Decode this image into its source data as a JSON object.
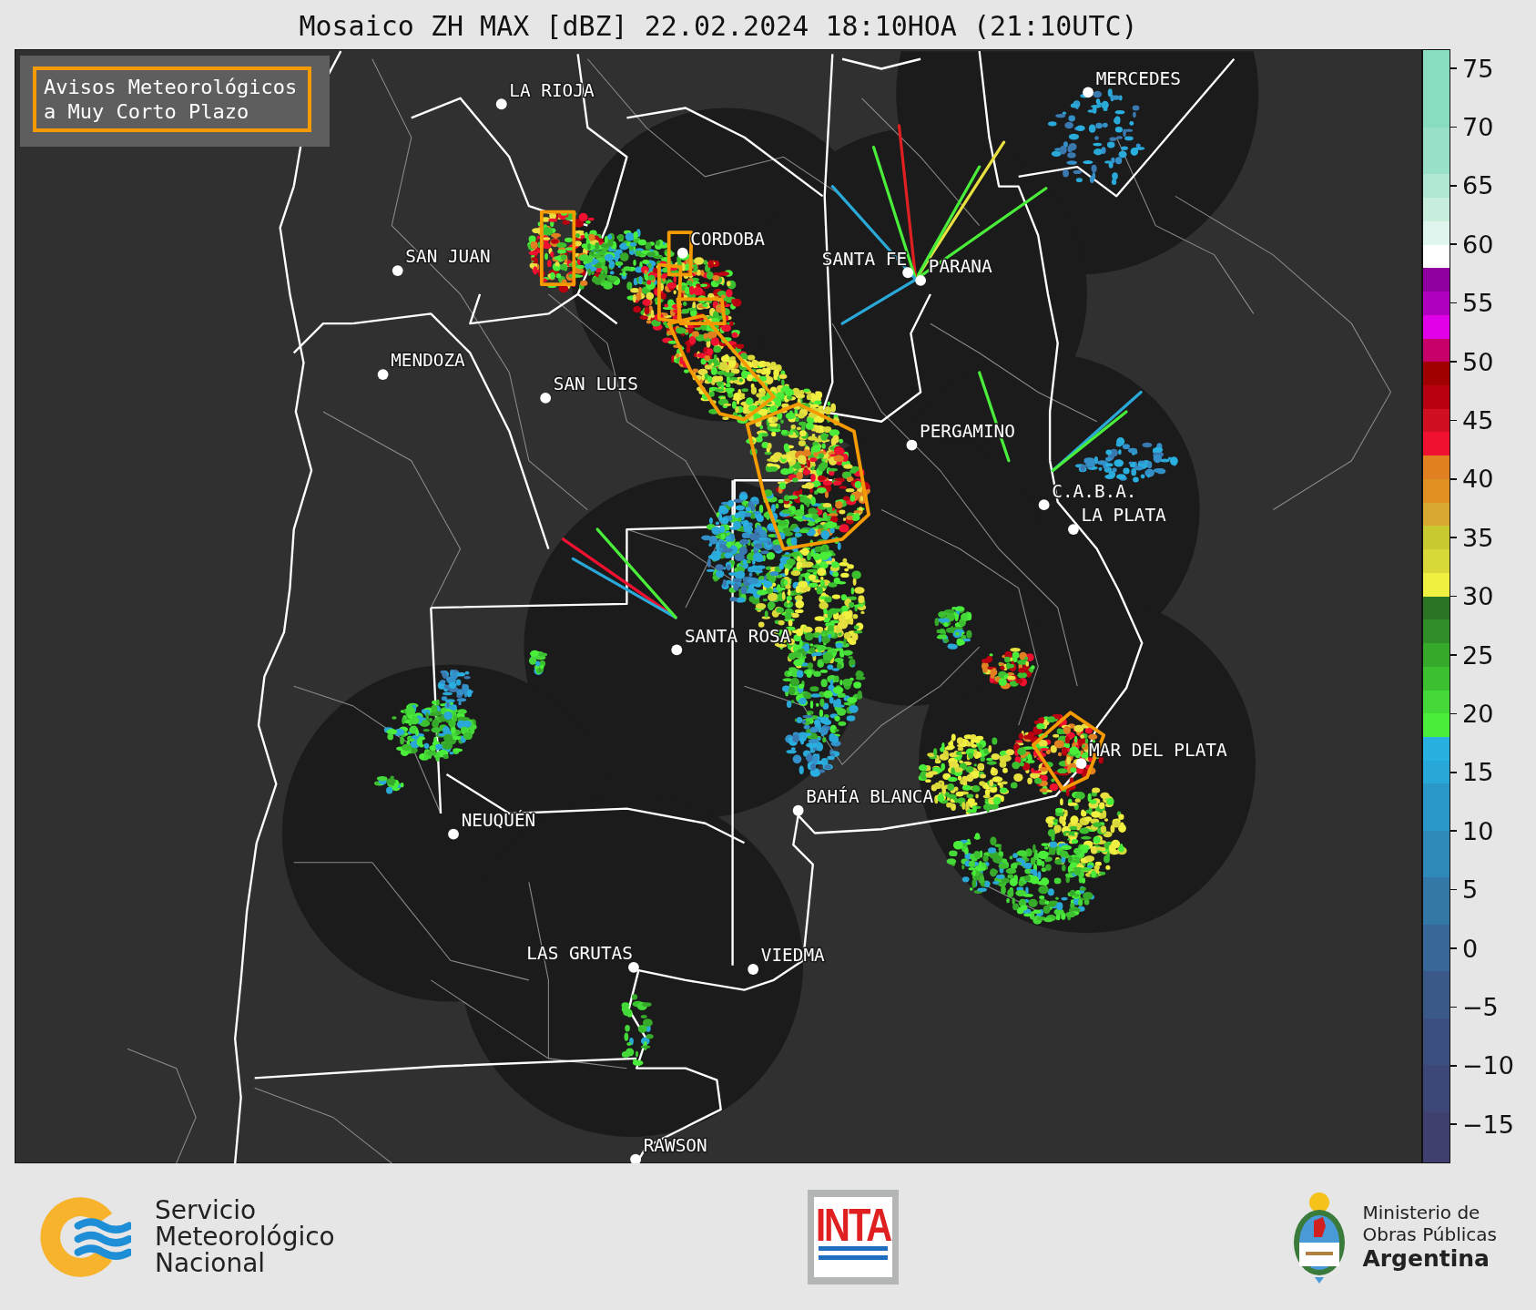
{
  "title": "Mosaico ZH MAX [dBZ] 22.02.2024 18:10HOA (21:10UTC)",
  "legend": {
    "lines": [
      "Avisos Meteorológicos",
      "a Muy Corto Plazo"
    ]
  },
  "map": {
    "cities": [
      {
        "name": "LA RIOJA"
      },
      {
        "name": "MERCEDES"
      },
      {
        "name": "CORDOBA"
      },
      {
        "name": "SAN JUAN"
      },
      {
        "name": "SANTA FE"
      },
      {
        "name": "PARANA"
      },
      {
        "name": "MENDOZA"
      },
      {
        "name": "SAN LUIS"
      },
      {
        "name": "PERGAMINO"
      },
      {
        "name": "C.A.B.A."
      },
      {
        "name": "LA PLATA"
      },
      {
        "name": "SANTA ROSA"
      },
      {
        "name": "MAR DEL PLATA"
      },
      {
        "name": "BAHÍA BLANCA"
      },
      {
        "name": "NEUQUÉN"
      },
      {
        "name": "LAS GRUTAS"
      },
      {
        "name": "VIEDMA"
      },
      {
        "name": "RAWSON"
      }
    ]
  },
  "colorbar": {
    "ticks": [
      "75",
      "70",
      "65",
      "60",
      "55",
      "50",
      "45",
      "40",
      "35",
      "30",
      "25",
      "20",
      "15",
      "10",
      "5",
      "0",
      "−5",
      "−10",
      "−15"
    ]
  },
  "footer": {
    "smn": {
      "lines": [
        "Servicio",
        "Meteorológico",
        "Nacional"
      ]
    },
    "inta": {
      "label": "INTA"
    },
    "ministry": {
      "lines": [
        "Ministerio de",
        "Obras Públicas",
        "Argentina"
      ]
    }
  }
}
